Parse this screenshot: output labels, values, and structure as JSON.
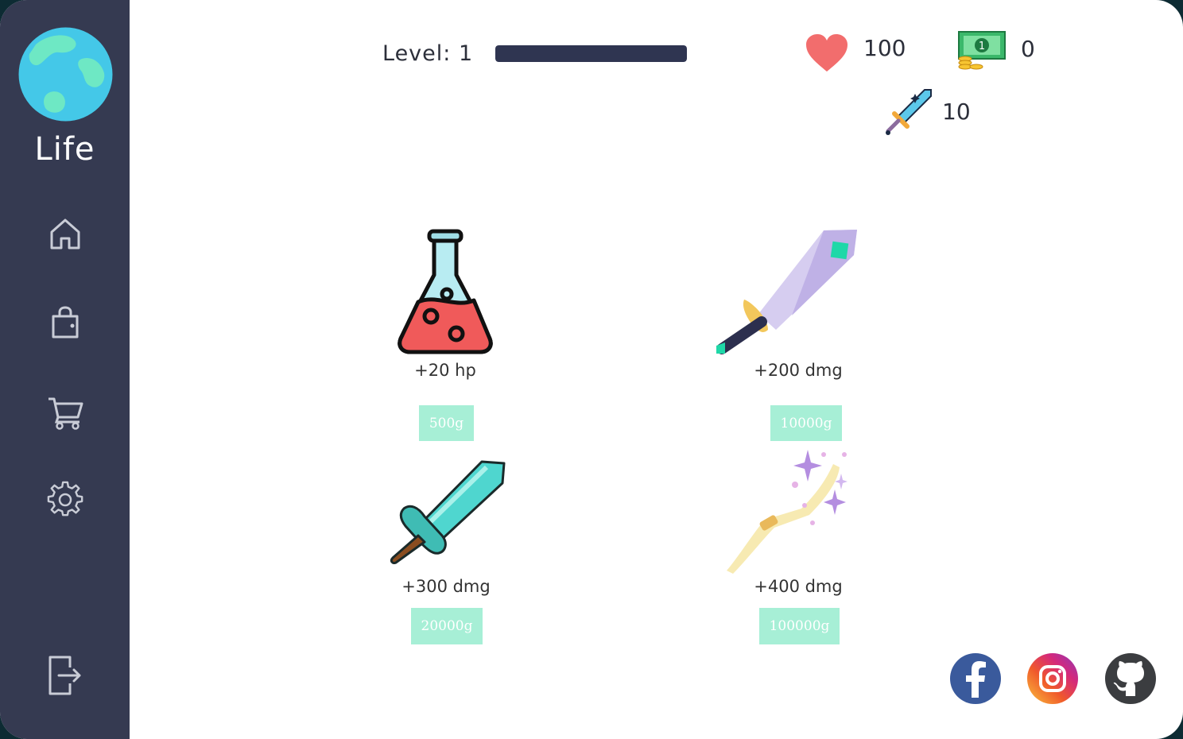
{
  "app": {
    "name": "Life"
  },
  "sidebar": {
    "items": [
      {
        "name": "home",
        "icon": "home-icon"
      },
      {
        "name": "inventory",
        "icon": "bag-icon"
      },
      {
        "name": "shop",
        "icon": "cart-icon"
      },
      {
        "name": "settings",
        "icon": "gear-icon"
      },
      {
        "name": "logout",
        "icon": "logout-icon"
      }
    ]
  },
  "stats": {
    "level_label": "Level: 1",
    "xp_progress": 1.0,
    "health": "100",
    "money": "0",
    "damage": "10"
  },
  "shop": {
    "items": [
      {
        "icon": "potion-flask-icon",
        "label": "+20 hp",
        "price": "500g"
      },
      {
        "icon": "crystal-sword-icon",
        "label": "+200 dmg",
        "price": "10000g"
      },
      {
        "icon": "diamond-sword-icon",
        "label": "+300 dmg",
        "price": "20000g"
      },
      {
        "icon": "magic-wand-icon",
        "label": "+400 dmg",
        "price": "100000g"
      }
    ]
  },
  "social": [
    "facebook-icon",
    "instagram-icon",
    "github-icon"
  ],
  "colors": {
    "sidebar": "#353a51",
    "accent_button": "#a7efd6",
    "xp_fill": "#2f3551",
    "heart": "#f26d6d"
  }
}
